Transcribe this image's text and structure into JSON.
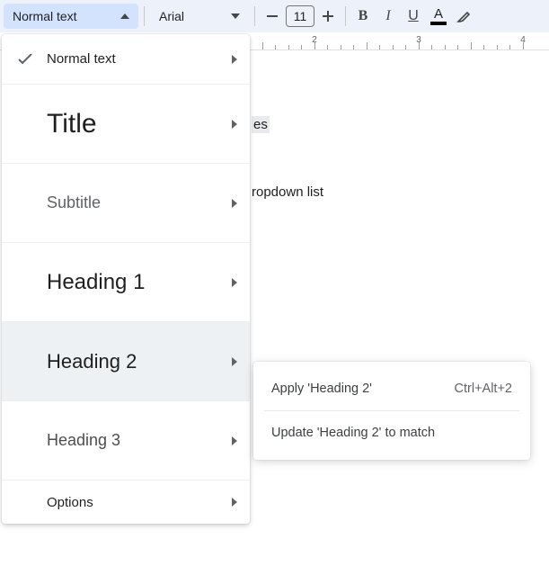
{
  "toolbar": {
    "style_selector": "Normal text",
    "font_selector": "Arial",
    "font_size": "11"
  },
  "ruler": {
    "numbers": [
      "2",
      "3",
      "4"
    ]
  },
  "document": {
    "fragment1": "es",
    "fragment2": "ropdown list"
  },
  "styles_menu": {
    "normal": "Normal text",
    "title": "Title",
    "subtitle": "Subtitle",
    "h1": "Heading 1",
    "h2": "Heading 2",
    "h3": "Heading 3",
    "options": "Options"
  },
  "submenu": {
    "apply_label": "Apply 'Heading 2'",
    "apply_shortcut": "Ctrl+Alt+2",
    "update_label": "Update 'Heading 2' to match"
  }
}
